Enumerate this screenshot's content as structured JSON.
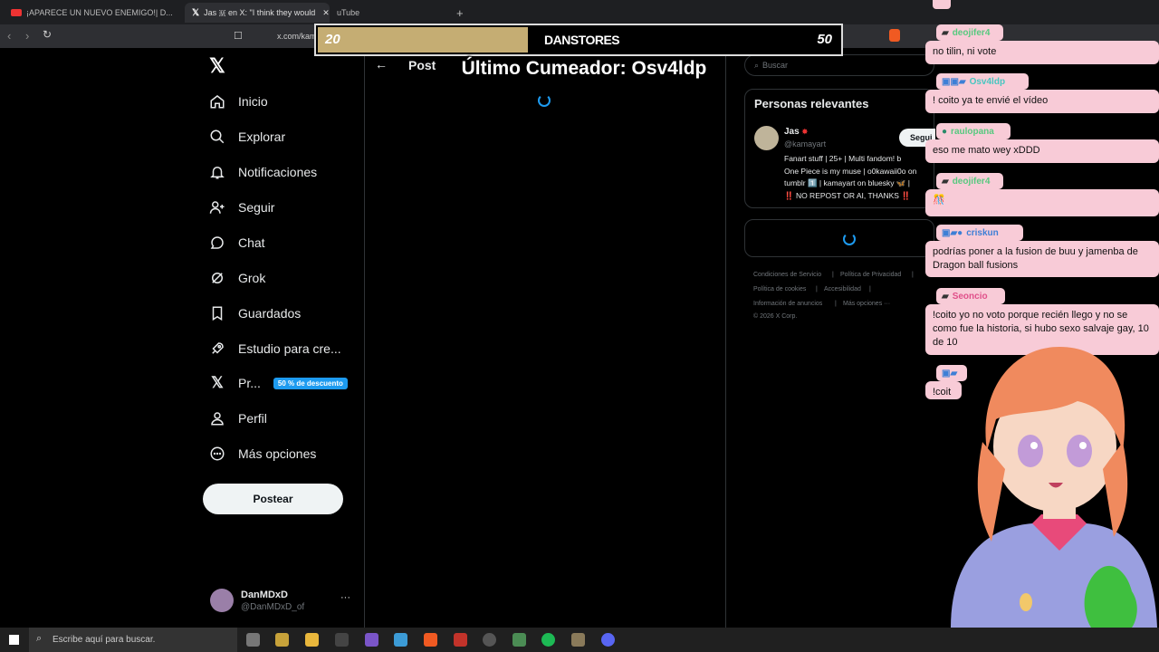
{
  "browser": {
    "tabs": [
      {
        "title": "¡APARECE UN NUEVO ENEMIGO!| D...",
        "favicon": "youtube-icon"
      },
      {
        "title": "Jas 🇲 en X: \"I think they would",
        "favicon": "x-icon"
      },
      {
        "title": "uTube",
        "favicon": "youtube-icon"
      }
    ],
    "url": "x.com/kam"
  },
  "sidebar": {
    "items": [
      {
        "label": "Inicio",
        "icon": "home-icon"
      },
      {
        "label": "Explorar",
        "icon": "search-icon"
      },
      {
        "label": "Notificaciones",
        "icon": "bell-icon"
      },
      {
        "label": "Seguir",
        "icon": "add-user-icon"
      },
      {
        "label": "Chat",
        "icon": "chat-icon"
      },
      {
        "label": "Grok",
        "icon": "grok-icon"
      },
      {
        "label": "Guardados",
        "icon": "bookmark-icon"
      },
      {
        "label": "Estudio para cre...",
        "icon": "rocket-icon"
      },
      {
        "label": "Pr...",
        "icon": "x-icon"
      },
      {
        "label": "Perfil",
        "icon": "person-icon"
      },
      {
        "label": "Más opciones",
        "icon": "more-circle-icon"
      }
    ],
    "premium_badge": "50 % de descuento",
    "post_button": "Postear",
    "account": {
      "name": "DanMDxD",
      "handle": "@DanMDxD_of",
      "more": "···"
    }
  },
  "main": {
    "title": "Post"
  },
  "right": {
    "search_placeholder": "Buscar",
    "relevant_title": "Personas relevantes",
    "person": {
      "name": "Jas",
      "handle": "@kamayart",
      "follow_label": "Segui",
      "bio_lines": [
        "Fanart stuff | 25+ | Multi fandom! b",
        "One Piece is my muse | o0kawaii0o on",
        "tumblr 1️⃣ | kamayart on bluesky 🦋 |",
        "‼️ NO REPOST OR AI, THANKS ‼️"
      ]
    },
    "footer": [
      "Condiciones de Servicio",
      "|",
      "Política de Privacidad",
      "|",
      "Política de cookies",
      "|",
      "Accesibilidad",
      "|",
      "Información de anuncios",
      "|",
      "Más opciones ···",
      "© 2026 X Corp."
    ]
  },
  "overlay": {
    "score_left": "20",
    "score_name": "DANSTORES",
    "score_right": "50",
    "cumeador": "Último Cumeador: Osv4ldp",
    "colors": {
      "bar_fill": "#c5ad73",
      "chat_bg": "#f8cbd7"
    }
  },
  "chat": [
    {
      "user": "deojifer4",
      "message": "no tilin, ni vote",
      "name_color": "#57c97f"
    },
    {
      "user": "Osv4ldp",
      "message": "! coito ya te envié el vídeo",
      "name_color": "#47c6c0"
    },
    {
      "user": "raulopana",
      "message": "eso me mato wey xDDD",
      "name_color": "#57c97f"
    },
    {
      "user": "deojifer4",
      "message": "🎊",
      "name_color": "#57c97f"
    },
    {
      "user": "criskun",
      "message": "podrías poner a la fusion de buu y jamenba de Dragon ball fusions",
      "name_color": "#3d7fd6"
    },
    {
      "user": "Seoncio",
      "message": "!coito yo no voto porque recién llego y no se como fue la historia, si hubo sexo salvaje gay, 10 de 10",
      "name_color": "#e0508a"
    },
    {
      "user": "",
      "message": "!coit",
      "name_color": "#3d7fd6"
    }
  ],
  "taskbar": {
    "search_placeholder": "Escribe aquí para buscar."
  }
}
